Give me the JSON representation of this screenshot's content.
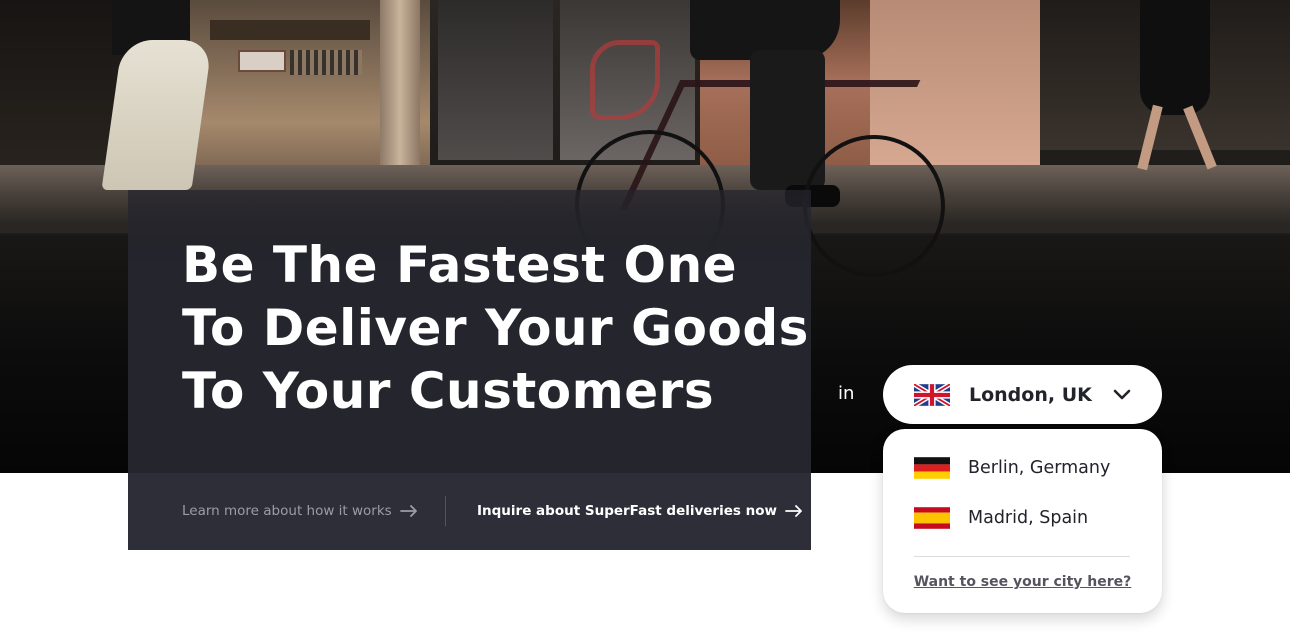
{
  "hero": {
    "headline_lines": [
      "Be The Fastest One",
      "To Deliver Your Goods",
      "To Your Customers"
    ],
    "links": {
      "learn_more": "Learn more about how it works",
      "inquire": "Inquire about SuperFast deliveries now"
    },
    "photo_icon": "street-bike-courier-photo"
  },
  "city_selector": {
    "prefix": "in",
    "selected": {
      "label": "London, UK",
      "flag": "uk-flag-icon"
    },
    "options": [
      {
        "label": "Berlin, Germany",
        "flag": "germany-flag-icon"
      },
      {
        "label": "Madrid, Spain",
        "flag": "spain-flag-icon"
      }
    ],
    "footer_link": "Want to see your city here?",
    "chevron_icon": "chevron-down-icon"
  },
  "colors": {
    "panel": "#25252e",
    "panel_footer": "#2e2e38",
    "text_light": "#ffffff",
    "text_muted": "#9c9ca8",
    "text_dark": "#23232b"
  }
}
